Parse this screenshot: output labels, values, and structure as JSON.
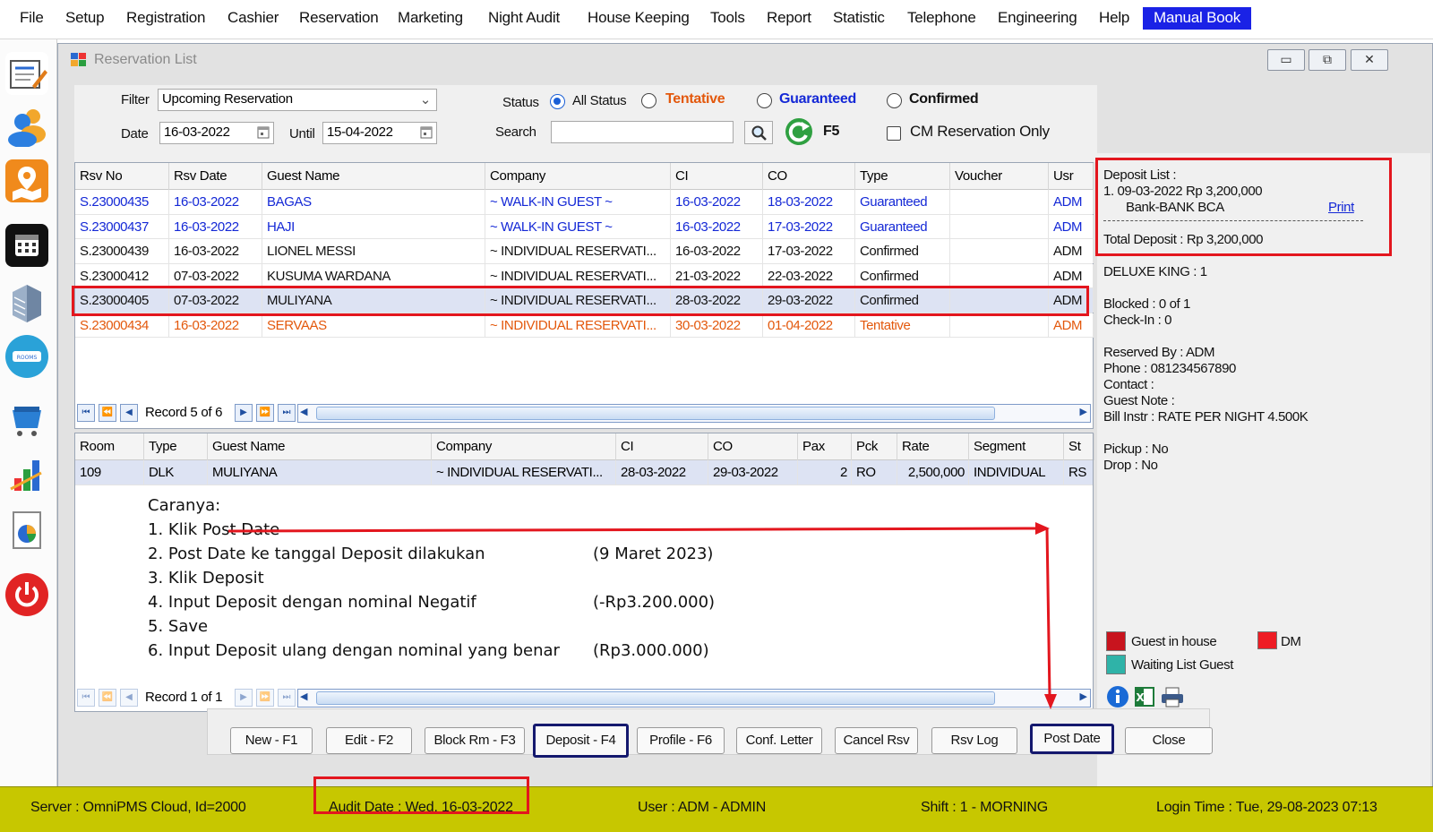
{
  "menu": [
    "File",
    "Setup",
    "Registration",
    "Cashier",
    "Reservation",
    "Marketing",
    "Night Audit",
    "House Keeping",
    "Tools",
    "Report",
    "Statistic",
    "Telephone",
    "Engineering",
    "Help",
    "Manual Book"
  ],
  "window": {
    "title": "Reservation List"
  },
  "filter": {
    "filter_label": "Filter",
    "filter_value": "Upcoming Reservation",
    "date_label": "Date",
    "date_value": "16-03-2022",
    "until_label": "Until",
    "until_value": "15-04-2022",
    "status_label": "Status",
    "status_options": [
      {
        "label": "All Status",
        "selected": true,
        "color": "#111111"
      },
      {
        "label": "Tentative",
        "selected": false,
        "color": "#e3580c"
      },
      {
        "label": "Guaranteed",
        "selected": false,
        "color": "#1428d6"
      },
      {
        "label": "Confirmed",
        "selected": false,
        "color": "#111111"
      }
    ],
    "search_label": "Search",
    "search_value": "",
    "refresh_key": "F5",
    "cm_only_label": "CM Reservation Only",
    "cm_only_checked": false
  },
  "reservations": {
    "columns": [
      "Rsv No",
      "Rsv Date",
      "Guest Name",
      "Company",
      "CI",
      "CO",
      "Type",
      "Voucher",
      "Usr"
    ],
    "rows": [
      {
        "cells": [
          "S.23000435",
          "16-03-2022",
          "BAGAS",
          "~ WALK-IN GUEST ~",
          "16-03-2022",
          "18-03-2022",
          "Guaranteed",
          "",
          "ADM"
        ],
        "color": "#1428d6",
        "selected": false
      },
      {
        "cells": [
          "S.23000437",
          "16-03-2022",
          "HAJI",
          "~ WALK-IN GUEST ~",
          "16-03-2022",
          "17-03-2022",
          "Guaranteed",
          "",
          "ADM"
        ],
        "color": "#1428d6",
        "selected": false
      },
      {
        "cells": [
          "S.23000439",
          "16-03-2022",
          "LIONEL MESSI",
          "~ INDIVIDUAL RESERVATI...",
          "16-03-2022",
          "17-03-2022",
          "Confirmed",
          "",
          "ADM"
        ],
        "color": "#111111",
        "selected": false
      },
      {
        "cells": [
          "S.23000412",
          "07-03-2022",
          "KUSUMA WARDANA",
          "~ INDIVIDUAL RESERVATI...",
          "21-03-2022",
          "22-03-2022",
          "Confirmed",
          "",
          "ADM"
        ],
        "color": "#111111",
        "selected": false
      },
      {
        "cells": [
          "S.23000405",
          "07-03-2022",
          "MULIYANA",
          "~ INDIVIDUAL RESERVATI...",
          "28-03-2022",
          "29-03-2022",
          "Confirmed",
          "",
          "ADM"
        ],
        "color": "#111111",
        "selected": true
      },
      {
        "cells": [
          "S.23000434",
          "16-03-2022",
          "SERVAAS",
          "~ INDIVIDUAL RESERVATI...",
          "30-03-2022",
          "01-04-2022",
          "Tentative",
          "",
          "ADM"
        ],
        "color": "#e3580c",
        "selected": false
      }
    ],
    "record_text": "Record 5 of 6"
  },
  "rooms": {
    "columns": [
      "Room",
      "Type",
      "Guest Name",
      "Company",
      "CI",
      "CO",
      "Pax",
      "Pck",
      "Rate",
      "Segment",
      "St"
    ],
    "rows": [
      [
        "109",
        "DLK",
        "MULIYANA",
        "~ INDIVIDUAL RESERVATI...",
        "28-03-2022",
        "29-03-2022",
        "2",
        "RO",
        "2,500,000",
        "INDIVIDUAL",
        "RS"
      ]
    ],
    "record_text": "Record 1 of 1"
  },
  "instructions": {
    "title": "Caranya:",
    "steps": [
      {
        "text": "1. Klik Post Date",
        "value": ""
      },
      {
        "text": "2. Post Date ke tanggal Deposit dilakukan",
        "value": "(9 Maret 2023)"
      },
      {
        "text": "3. Klik Deposit",
        "value": ""
      },
      {
        "text": "4. Input Deposit dengan nominal Negatif",
        "value": "(-Rp3.200.000)"
      },
      {
        "text": "5. Save",
        "value": ""
      },
      {
        "text": "6. Input Deposit ulang dengan nominal yang benar",
        "value": "(Rp3.000.000)"
      }
    ]
  },
  "buttons": [
    "New - F1",
    "Edit - F2",
    "Block Rm - F3",
    "Deposit - F4",
    "Profile  - F6",
    "Conf. Letter",
    "Cancel Rsv",
    "Rsv Log",
    "Post Date",
    "Close"
  ],
  "deposit": {
    "title": "Deposit List :",
    "entry": "1. 09-03-2022   Rp 3,200,000",
    "bank": "Bank-BANK BCA",
    "print": "Print",
    "total": "Total Deposit : Rp 3,200,000"
  },
  "details": [
    "DELUXE KING : 1",
    "Blocked : 0 of 1",
    "Check-In : 0",
    "Reserved By : ADM",
    "Phone : 081234567890",
    "Contact :",
    "Guest Note :",
    "Bill Instr : RATE PER NIGHT 4.500K",
    "Pickup : No",
    "Drop : No"
  ],
  "legend": [
    {
      "label": "Guest in house",
      "color": "#c8141e"
    },
    {
      "label": "DM",
      "color": "#ee1c24"
    },
    {
      "label": "Waiting List Guest",
      "color": "#2fb3a8"
    }
  ],
  "status_bar": {
    "server": "Server : OmniPMS Cloud, Id=2000",
    "audit_date": "Audit Date : Wed, 16-03-2022",
    "user": "User : ADM - ADMIN",
    "shift": "Shift : 1 - MORNING",
    "login": "Login Time : Tue, 29-08-2023 07:13"
  }
}
